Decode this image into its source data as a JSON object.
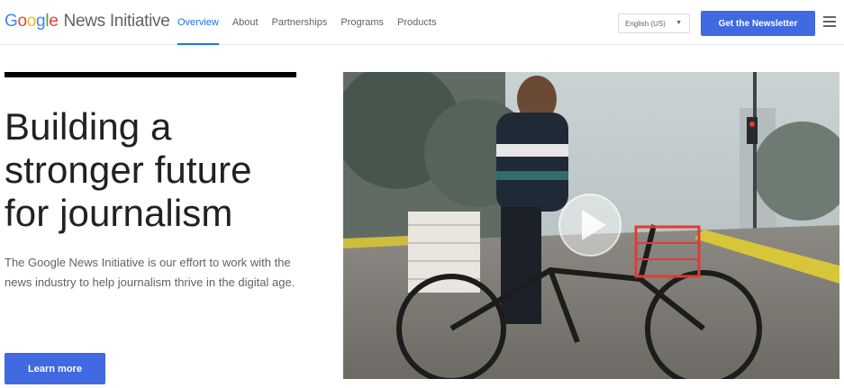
{
  "header": {
    "logo_word": [
      "G",
      "o",
      "o",
      "g",
      "l",
      "e"
    ],
    "logo_suffix": "News Initiative",
    "nav": [
      {
        "label": "Overview",
        "active": true
      },
      {
        "label": "About",
        "active": false
      },
      {
        "label": "Partnerships",
        "active": false
      },
      {
        "label": "Programs",
        "active": false
      },
      {
        "label": "Products",
        "active": false
      }
    ],
    "language": "English (US)",
    "newsletter_button": "Get the Newsletter"
  },
  "hero": {
    "headline_lines": [
      "Building a",
      "stronger future",
      "for journalism"
    ],
    "description": "The Google News Initiative is our effort to work with the news industry to help journalism thrive in the digital age.",
    "cta": "Learn more"
  },
  "video": {
    "play_icon": "play-icon"
  },
  "colors": {
    "accent": "#1a73e8",
    "button": "#4169e1",
    "text": "#202124",
    "muted": "#5f6368"
  }
}
